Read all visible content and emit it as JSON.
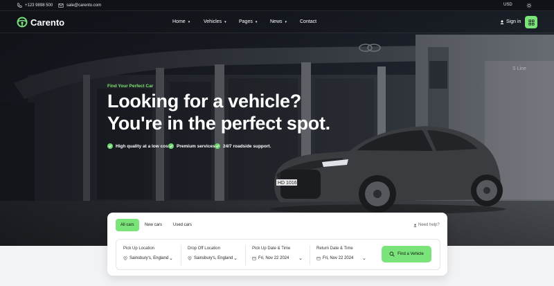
{
  "topbar": {
    "phone": "+123 9898 500",
    "email": "sale@carento.com",
    "currency": "USD"
  },
  "nav": {
    "logo_text": "Carento",
    "menu": [
      {
        "label": "Home"
      },
      {
        "label": "Vehicles"
      },
      {
        "label": "Pages"
      },
      {
        "label": "News"
      },
      {
        "label": "Contact"
      }
    ],
    "sign_in": "Sign in"
  },
  "hero": {
    "eyebrow": "Find Your Perfect Car",
    "headline_line1": "Looking for a vehicle?",
    "headline_line2": "You're in the perfect spot.",
    "features": [
      "High quality at a low cost.",
      "Premium services",
      "24/7 roadside support."
    ],
    "plate": "HD 1016"
  },
  "search": {
    "tabs": [
      "All cars",
      "New cars",
      "Used cars"
    ],
    "active_tab": "All cars",
    "help": "Need help?",
    "fields": [
      {
        "label": "Pick Up Location",
        "value": "Sainsbury's, England",
        "icon": "location-pin-icon"
      },
      {
        "label": "Drop Off Location",
        "value": "Sainsbury's, England",
        "icon": "location-pin-icon"
      },
      {
        "label": "Pick Up Date & Time",
        "value": "Fri, Nov 22 2024",
        "icon": "calendar-icon"
      },
      {
        "label": "Return Date & Time",
        "value": "Fri, Nov 22 2024",
        "icon": "calendar-icon"
      }
    ],
    "find_button": "Find a Vehicle"
  },
  "colors": {
    "accent": "#7ae37a",
    "dark": "#101217"
  }
}
